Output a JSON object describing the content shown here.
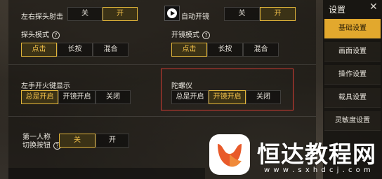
{
  "settings": {
    "left_probe_fire": {
      "label": "左右探头射击",
      "options": [
        "关",
        "开"
      ],
      "selected": 1
    },
    "auto_door": {
      "label": "自动开镜",
      "options": [
        "关",
        "开"
      ],
      "selected": 1
    },
    "probe_mode": {
      "label": "探头模式",
      "help": "?",
      "options": [
        "点击",
        "长按",
        "混合"
      ],
      "selected": 0
    },
    "scope_mode": {
      "label": "开镜模式",
      "help": "?",
      "options": [
        "点击",
        "长按",
        "混合"
      ],
      "selected": 0
    },
    "left_fire_display": {
      "label": "左手开火键显示",
      "options": [
        "总是开启",
        "开镜开启",
        "关闭"
      ],
      "selected": 0
    },
    "gyroscope": {
      "label": "陀螺仪",
      "options": [
        "总是开启",
        "开镜开启",
        "关闭"
      ],
      "selected": 1
    },
    "first_person_switch": {
      "label_line1": "第一人称",
      "label_line2": "切换按钮",
      "help": "?",
      "options": [
        "关",
        "开"
      ],
      "selected": 0
    }
  },
  "sidebar": {
    "title": "设置",
    "close": "✕",
    "items": [
      {
        "label": "基础设置",
        "active": true
      },
      {
        "label": "画面设置",
        "active": false
      },
      {
        "label": "操作设置",
        "active": false
      },
      {
        "label": "载具设置",
        "active": false
      },
      {
        "label": "灵敏度设置",
        "active": false
      }
    ]
  },
  "watermark": {
    "text": "恒达教程网",
    "url": "w w w . s x h d c j . c o m"
  },
  "colors": {
    "accent": "#e2a82d",
    "selected_text": "#f2c04a",
    "highlight_box": "#d33c33"
  }
}
